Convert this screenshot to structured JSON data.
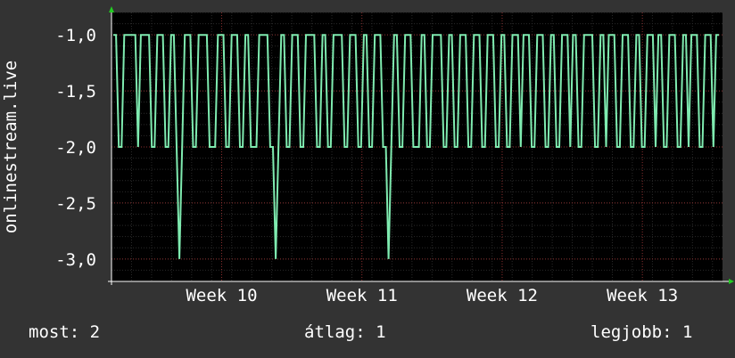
{
  "chart_data": {
    "type": "line",
    "ylabel": "onlinestream.live",
    "ylim": [
      -3.2,
      -0.8
    ],
    "yticks": [
      -1.0,
      -1.5,
      -2.0,
      -2.5,
      -3.0
    ],
    "ytick_labels": [
      "-1,0",
      "-1,5",
      "-2,0",
      "-2,5",
      "-3,0"
    ],
    "xtick_labels": [
      "Week 10",
      "Week 11",
      "Week 12",
      "Week 13"
    ],
    "x_days_span": 30.5,
    "xtick_days": [
      5.5,
      12.5,
      19.5,
      26.5
    ],
    "series": [
      {
        "color": "#7FEBB0",
        "values": [
          -1,
          -1,
          -2,
          -2,
          -1,
          -1,
          -1,
          -1,
          -1,
          -2,
          -1,
          -1,
          -1,
          -1,
          -2,
          -2,
          -1,
          -1,
          -1,
          -2,
          -2,
          -1,
          -1,
          -2,
          -3,
          -2,
          -1,
          -1,
          -1,
          -2,
          -2,
          -1,
          -1,
          -1,
          -1,
          -2,
          -2,
          -2,
          -1,
          -1,
          -1,
          -2,
          -2,
          -1,
          -1,
          -1,
          -2,
          -2,
          -1,
          -1,
          -2,
          -2,
          -2,
          -1,
          -1,
          -1,
          -1,
          -2,
          -2,
          -3,
          -2,
          -1,
          -1,
          -2,
          -2,
          -1,
          -1,
          -1,
          -2,
          -2,
          -1,
          -1,
          -1,
          -1,
          -2,
          -2,
          -1,
          -1,
          -2,
          -2,
          -1,
          -1,
          -1,
          -1,
          -2,
          -2,
          -1,
          -1,
          -1,
          -2,
          -2,
          -1,
          -1,
          -2,
          -2,
          -1,
          -1,
          -1,
          -2,
          -2,
          -3,
          -2,
          -1,
          -1,
          -2,
          -2,
          -1,
          -1,
          -1,
          -2,
          -2,
          -2,
          -1,
          -1,
          -2,
          -2,
          -1,
          -1,
          -1,
          -1,
          -2,
          -2,
          -1,
          -1,
          -2,
          -2,
          -1,
          -1,
          -1,
          -2,
          -2,
          -1,
          -1,
          -1,
          -2,
          -2,
          -1,
          -1,
          -1,
          -2,
          -2,
          -1,
          -1,
          -2,
          -2,
          -1,
          -1,
          -1,
          -2,
          -1,
          -1,
          -1,
          -2,
          -2,
          -1,
          -1,
          -1,
          -2,
          -2,
          -1,
          -1,
          -2,
          -2,
          -1,
          -1,
          -1,
          -2,
          -1,
          -1,
          -2,
          -2,
          -1,
          -1,
          -1,
          -1,
          -2,
          -2,
          -1,
          -1,
          -2,
          -1,
          -1,
          -1,
          -2,
          -2,
          -1,
          -1,
          -1,
          -2,
          -2,
          -1,
          -1,
          -2,
          -2,
          -1,
          -1,
          -1,
          -2,
          -1,
          -1,
          -2,
          -2,
          -1,
          -1,
          -1,
          -2,
          -2,
          -1,
          -1,
          -2,
          -1,
          -1,
          -1,
          -2,
          -2,
          -1,
          -1,
          -1,
          -2,
          -1,
          -1
        ]
      }
    ],
    "grid": true,
    "background": "#000000"
  },
  "stats": {
    "now_label": "most:",
    "now_value": "2",
    "avg_label": "átlag:",
    "avg_value": "1",
    "best_label": "legjobb:",
    "best_value": "1"
  }
}
